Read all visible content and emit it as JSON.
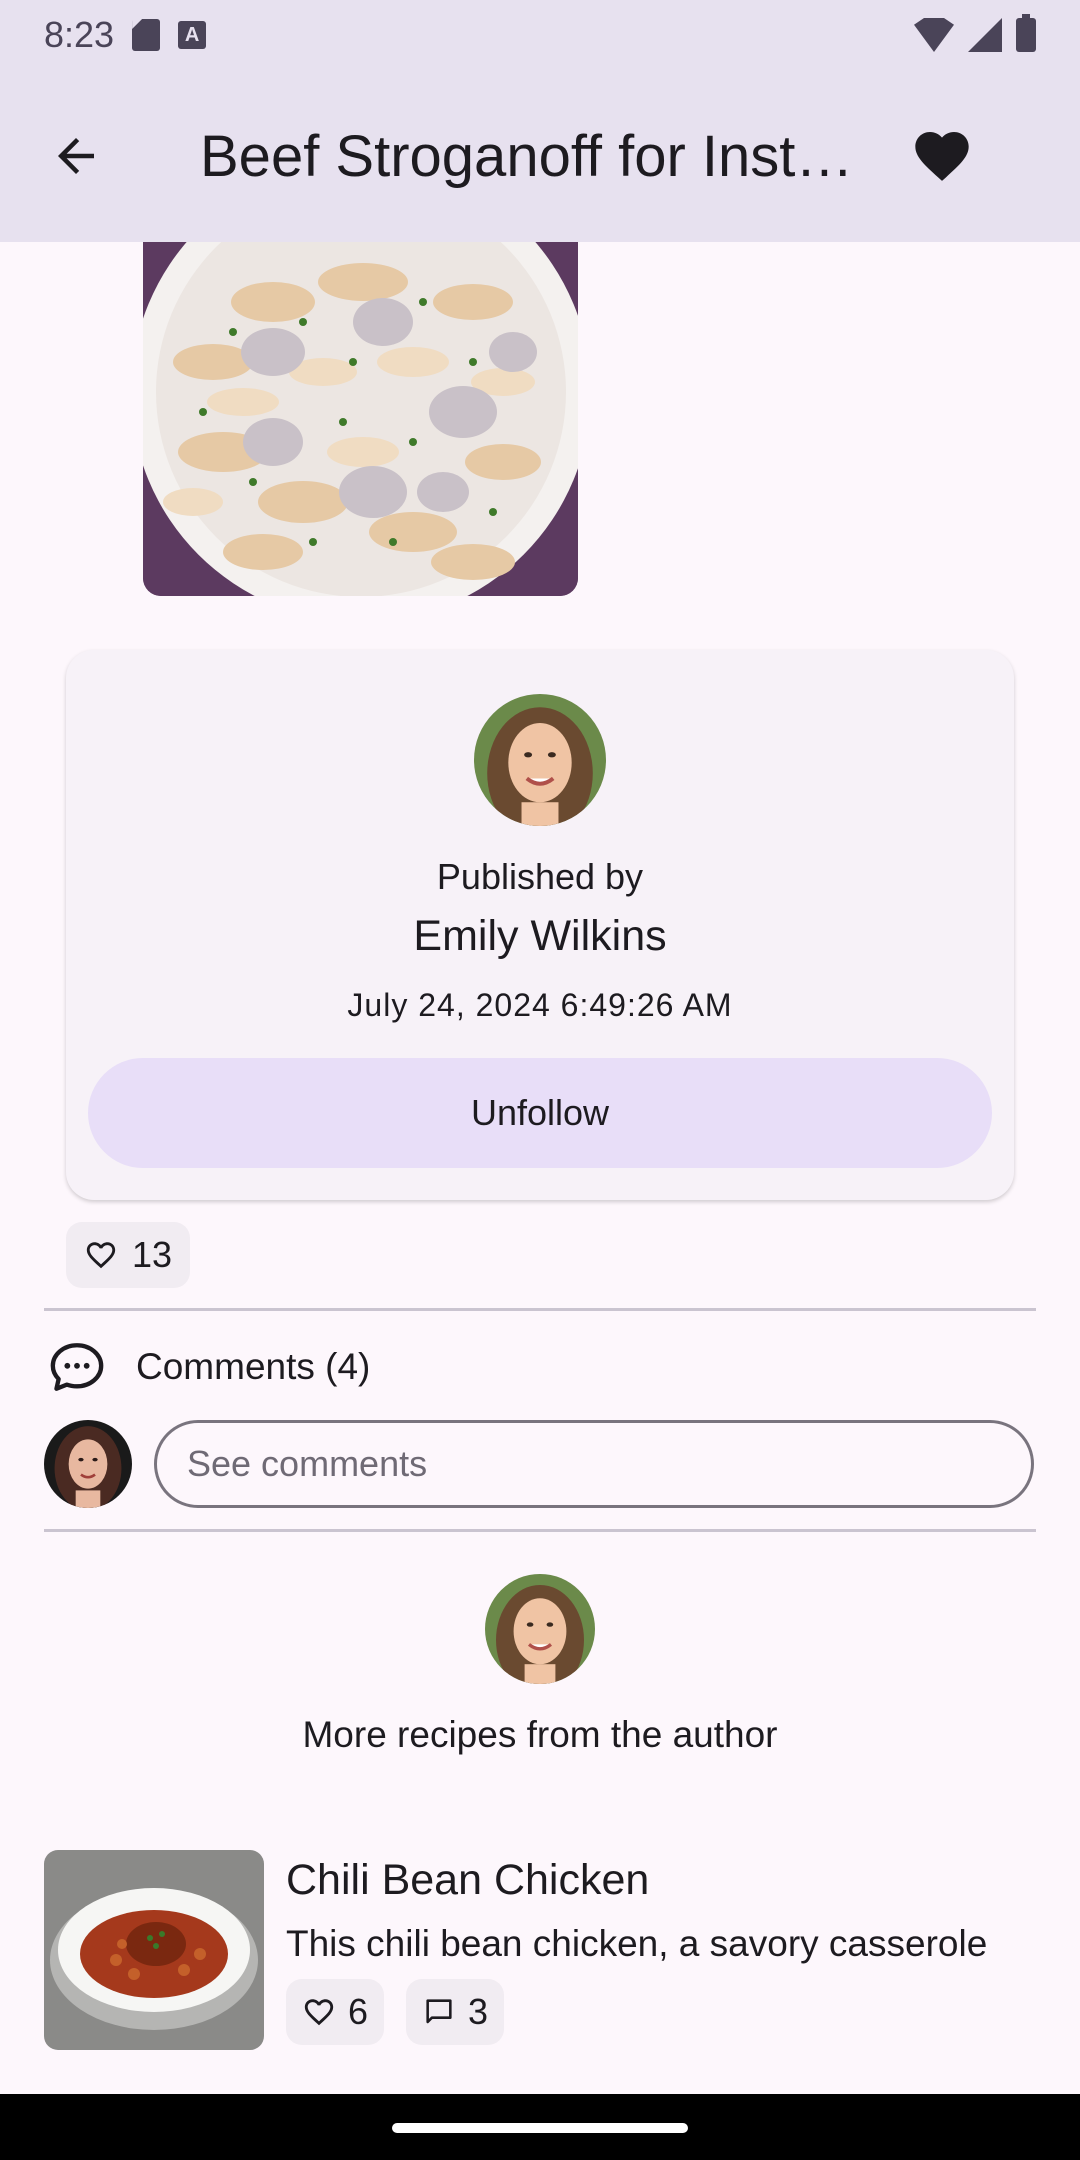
{
  "status_bar": {
    "time": "8:23"
  },
  "app_bar": {
    "title": "Beef Stroganoff for Instant Pot",
    "favorite_active": true
  },
  "author_card": {
    "published_label": "Published by",
    "author_name": "Emily Wilkins",
    "published_date": "July 24, 2024 6:49:26 AM",
    "unfollow_label": "Unfollow"
  },
  "likes": {
    "count": "13"
  },
  "comments": {
    "title": "Comments (4)",
    "input_placeholder": "See comments"
  },
  "more_from_author": {
    "label": "More recipes from the author"
  },
  "recipes": [
    {
      "title": "Chili Bean Chicken",
      "description": "This chili bean chicken, a savory casserole",
      "likes": "6",
      "comments": "3"
    }
  ],
  "colors": {
    "app_bar_bg": "#e7e1ef",
    "page_bg": "#fdf7fc",
    "button_tonal": "#e8def8",
    "chip_bg": "#f1ecf2"
  }
}
